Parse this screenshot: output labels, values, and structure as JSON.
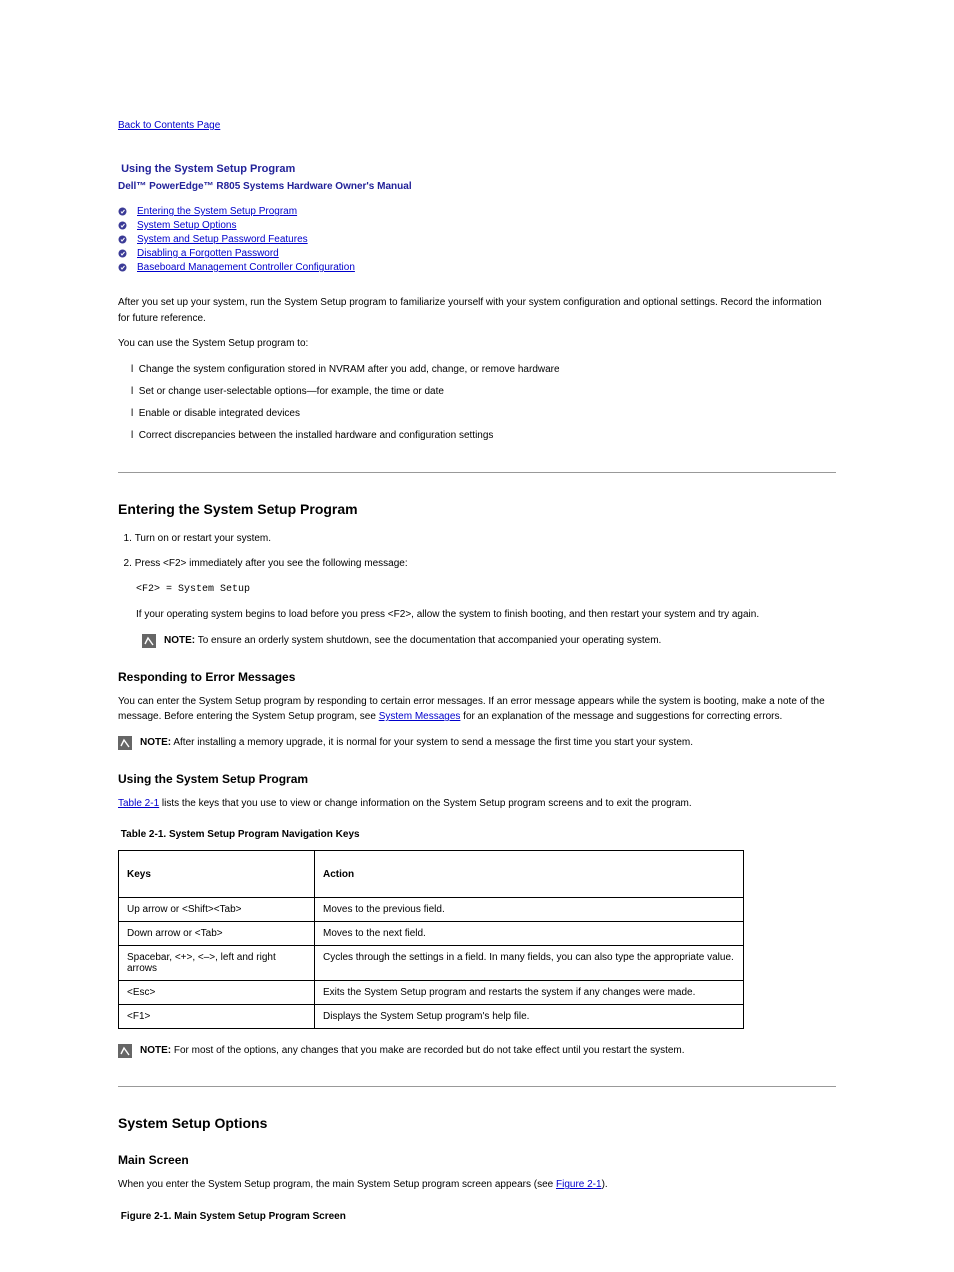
{
  "back_link": "Back to Contents Page",
  "doc_heading": "Using the System Setup Program",
  "doc_subtitle": "Dell™ PowerEdge™ R805 Systems Hardware Owner's Manual",
  "toc": [
    "Entering the System Setup Program",
    "System Setup Options",
    "System and Setup Password Features",
    "Disabling a Forgotten Password",
    "Baseboard Management Controller Configuration"
  ],
  "intro_lead": "After you set up your system, run the System Setup program to familiarize yourself with your system configuration and optional settings. Record the information for future reference.",
  "intro_uses_label": "You can use the System Setup program to:",
  "intro_uses": [
    "Change the system configuration stored in NVRAM after you add, change, or remove hardware",
    "Set or change user-selectable options—for example, the time or date",
    "Enable or disable integrated devices",
    "Correct discrepancies between the installed hardware and configuration settings"
  ],
  "s1": {
    "title": "Entering the System Setup Program",
    "step1": "Turn on or restart your system.",
    "step2": "Press <F2> immediately after you see the following message:",
    "code_line": "<F2> = System Setup",
    "after_code": "If your operating system begins to load before you press <F2>, allow the system to finish booting, and then restart your system and try again.",
    "note1_label": "NOTE:",
    "note1_text": "To ensure an orderly system shutdown, see the documentation that accompanied your operating system.",
    "err_title": "Responding to Error Messages",
    "err_p1_a": "You can enter the System Setup program by responding to certain error messages. If an error message appears while the system is booting, make a note of the message. Before entering the System Setup program, see ",
    "err_p1_link": "System Messages",
    "err_p1_b": " for an explanation of the message and suggestions for correcting errors.",
    "note2_label": "NOTE:",
    "note2_text": "After installing a memory upgrade, it is normal for your system to send a message the first time you start your system.",
    "nav_title": "Using the System Setup Program",
    "nav_p_a": "Table 2-1",
    "nav_p_b": " lists the keys that you use to view or change information on the System Setup program screens and to exit the program.",
    "table_caption": "Table 2-1. System Setup Program Navigation Keys",
    "table": {
      "headers": [
        "Keys",
        "Action"
      ],
      "rows": [
        [
          "Up arrow or <Shift><Tab>",
          "Moves to the previous field."
        ],
        [
          "Down arrow or <Tab>",
          "Moves to the next field."
        ],
        [
          "Spacebar, <+>, <–>, left and right arrows",
          "Cycles through the settings in a field. In many fields, you can also type the appropriate value."
        ],
        [
          "<Esc>",
          "Exits the System Setup program and restarts the system if any changes were made."
        ],
        [
          "<F1>",
          "Displays the System Setup program's help file."
        ]
      ]
    },
    "note3_label": "NOTE:",
    "note3_text": "For most of the options, any changes that you make are recorded but do not take effect until you restart the system."
  },
  "s2": {
    "title": "System Setup Options",
    "main_title": "Main Screen",
    "p1_a": "When you enter the System Setup program, the main System Setup program screen appears (see ",
    "p1_link": "Figure 2-1",
    "p1_b": ").",
    "fig_caption": "Figure 2-1. Main System Setup Program Screen"
  }
}
